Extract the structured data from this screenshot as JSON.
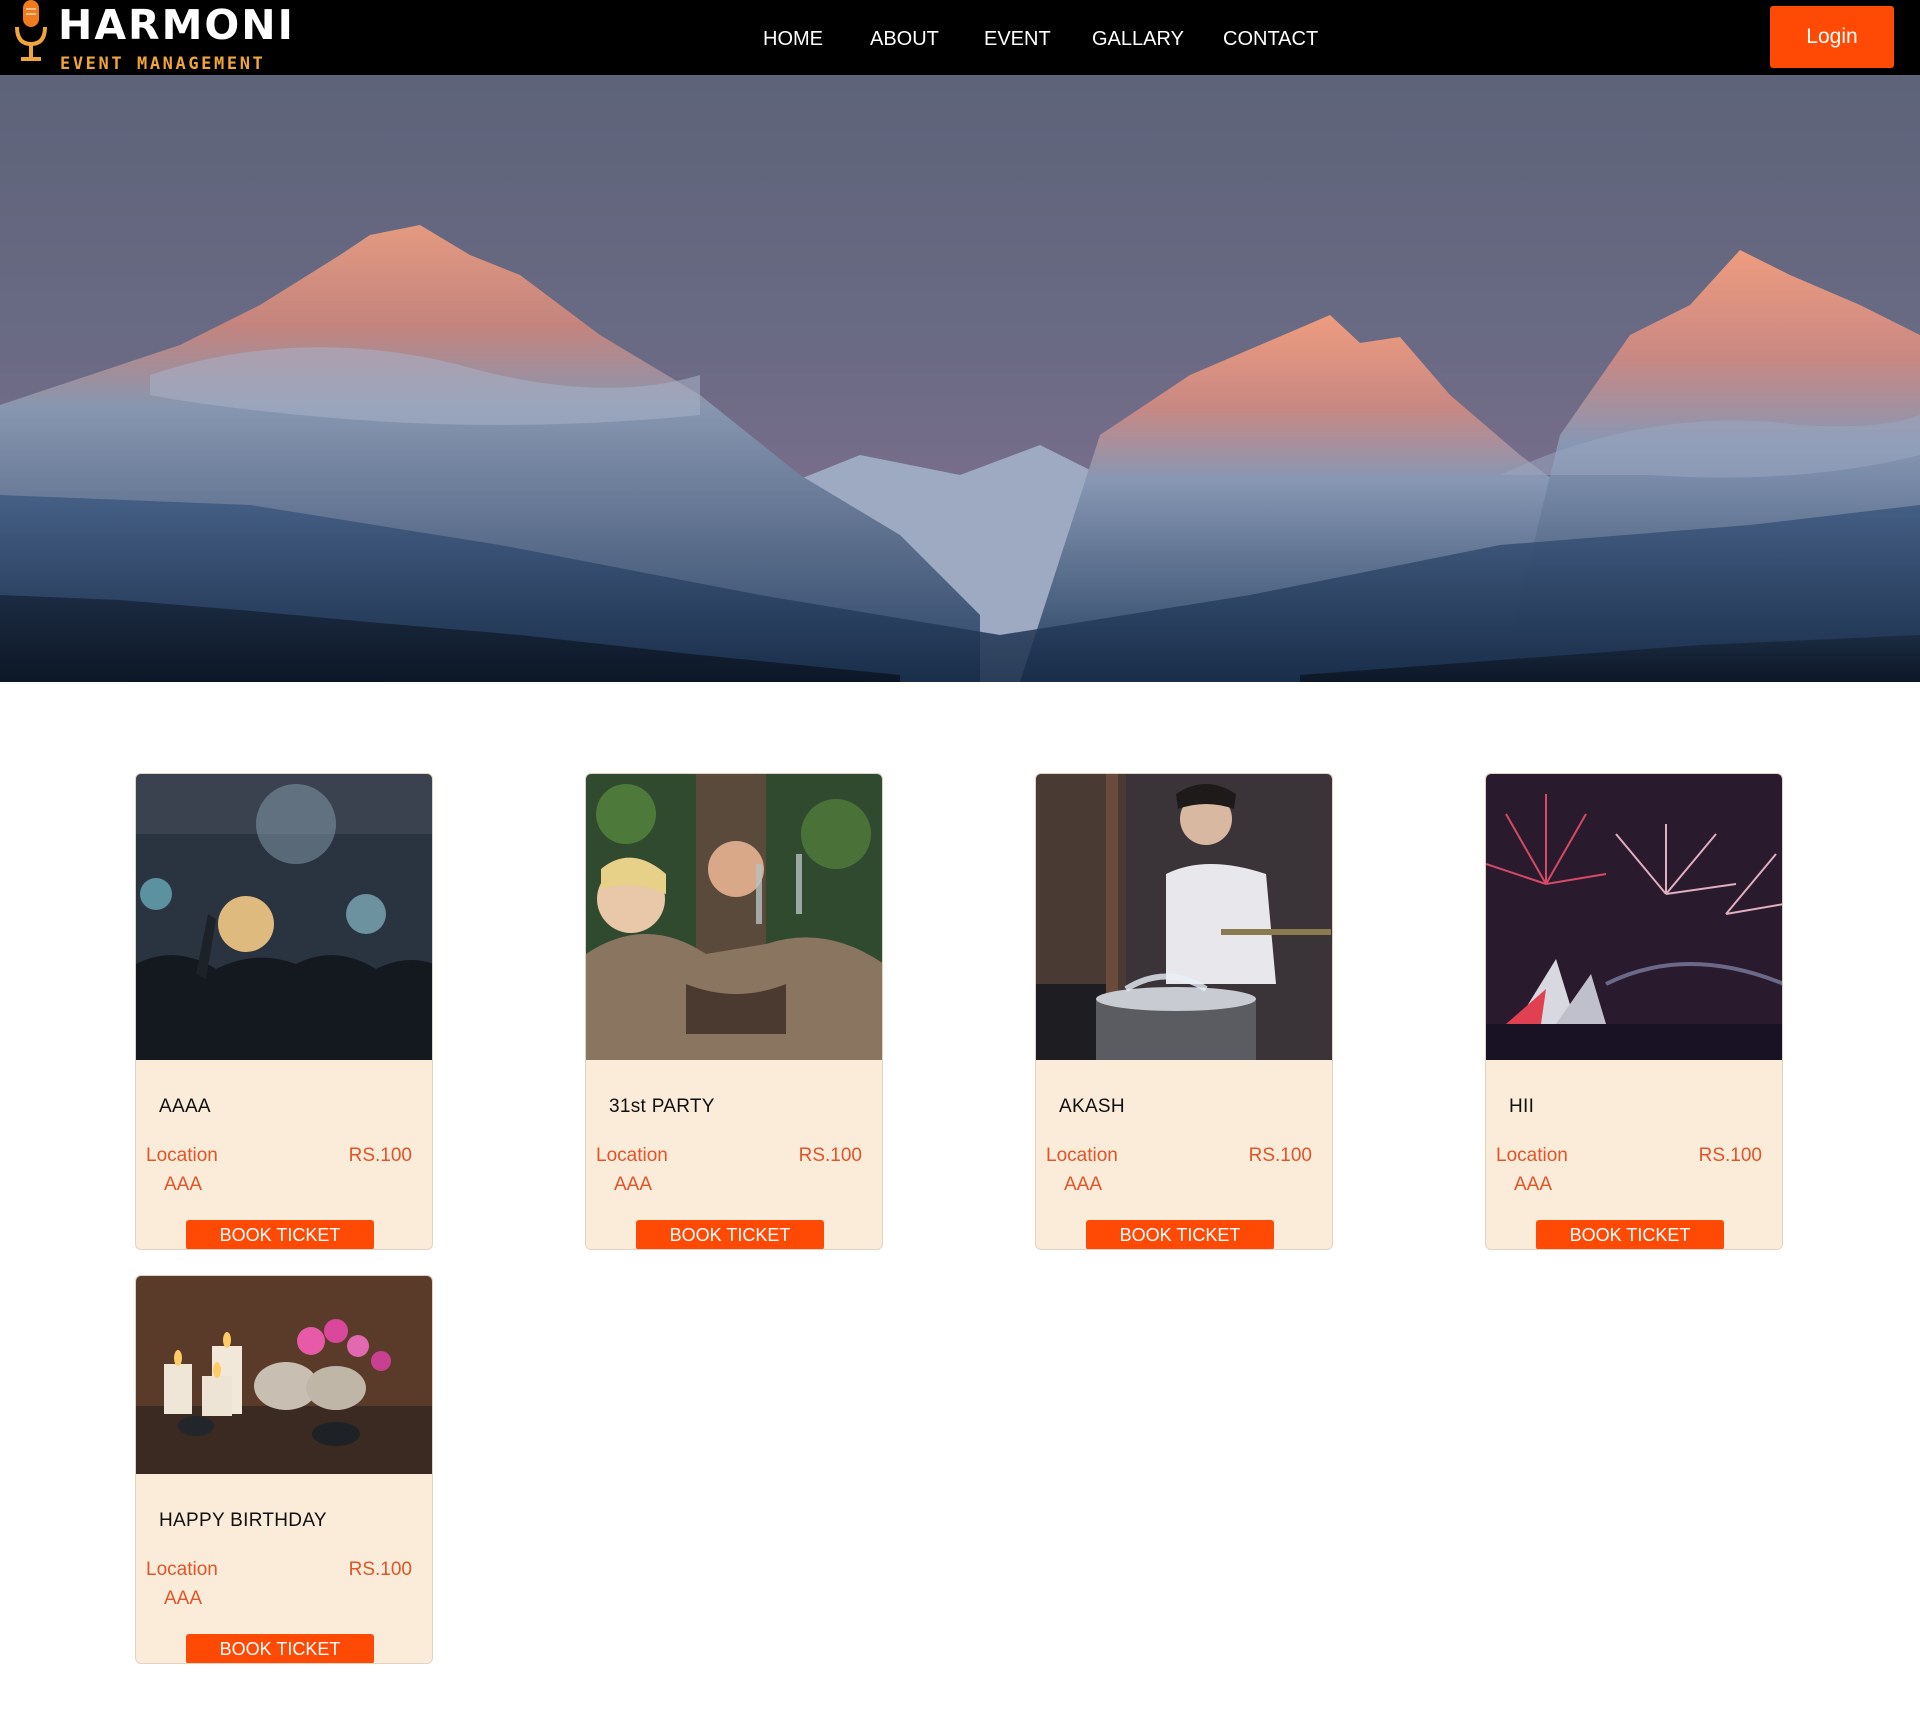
{
  "brand": {
    "title": "HARMONI",
    "subtitle": "EVENT MANAGEMENT"
  },
  "nav": {
    "links": [
      "HOME",
      "ABOUT",
      "EVENT",
      "GALLARY",
      "CONTACT"
    ],
    "login_label": "Login"
  },
  "colors": {
    "accent": "#ff4a05",
    "card_bg": "#fbebd9",
    "text_accent": "#e0552a",
    "navbar": "#000000"
  },
  "events": [
    {
      "title": "AAAA",
      "location_label": "Location",
      "location": "AAA",
      "price": "RS.100",
      "button": "BOOK TICKET",
      "image": "concert-crowd"
    },
    {
      "title": "31st PARTY",
      "location_label": "Location",
      "location": "AAA",
      "price": "RS.100",
      "button": "BOOK TICKET",
      "image": "friends-toasting"
    },
    {
      "title": "AKASH",
      "location_label": "Location",
      "location": "AAA",
      "price": "RS.100",
      "button": "BOOK TICKET",
      "image": "drummer"
    },
    {
      "title": "HII",
      "location_label": "Location",
      "location": "AAA",
      "price": "RS.100",
      "button": "BOOK TICKET",
      "image": "fireworks-opera-house"
    },
    {
      "title": "HAPPY BIRTHDAY",
      "location_label": "Location",
      "location": "AAA",
      "price": "RS.100",
      "button": "BOOK TICKET",
      "image": "spa-candles-orchid"
    }
  ]
}
